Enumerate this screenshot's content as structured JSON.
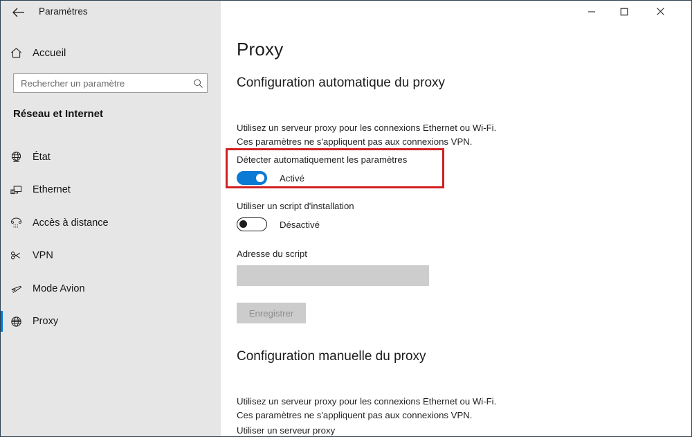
{
  "window": {
    "title": "Paramètres",
    "back_icon": "back-arrow-icon",
    "minimize_label": "—",
    "maximize_label": "□",
    "close_label": "✕",
    "accent_color": "#0078d7",
    "sidebar_bg": "#e6e6e6",
    "highlight_color": "#d32020"
  },
  "sidebar": {
    "home": {
      "label": "Accueil",
      "icon": "home-icon"
    },
    "search": {
      "placeholder": "Rechercher un paramètre",
      "value": "",
      "icon": "search-icon"
    },
    "category": "Réseau et Internet",
    "items": [
      {
        "label": "État",
        "icon": "globe-status-icon",
        "selected": false
      },
      {
        "label": "Ethernet",
        "icon": "ethernet-monitor-icon",
        "selected": false
      },
      {
        "label": "Accès à distance",
        "icon": "dial-up-phone-icon",
        "selected": false
      },
      {
        "label": "VPN",
        "icon": "vpn-key-icon",
        "selected": false
      },
      {
        "label": "Mode Avion",
        "icon": "airplane-icon",
        "selected": false
      },
      {
        "label": "Proxy",
        "icon": "globe-proxy-icon",
        "selected": true
      }
    ]
  },
  "content": {
    "page_title": "Proxy",
    "auto_section": {
      "heading": "Configuration automatique du proxy",
      "description_line1": "Utilisez un serveur proxy pour les connexions Ethernet ou Wi-Fi.",
      "description_line2": "Ces paramètres ne s'appliquent pas aux connexions VPN.",
      "detect_label": "Détecter automatiquement les paramètres",
      "detect_state": "Activé",
      "script_label": "Utiliser un script d'installation",
      "script_state": "Désactivé",
      "script_address_label": "Adresse du script",
      "script_address_value": "",
      "save_label": "Enregistrer"
    },
    "manual_section": {
      "heading": "Configuration manuelle du proxy",
      "description_line1": "Utilisez un serveur proxy pour les connexions Ethernet ou Wi-Fi.",
      "description_line2": "Ces paramètres ne s'appliquent pas aux connexions VPN.",
      "use_proxy_label": "Utiliser un serveur proxy"
    }
  }
}
